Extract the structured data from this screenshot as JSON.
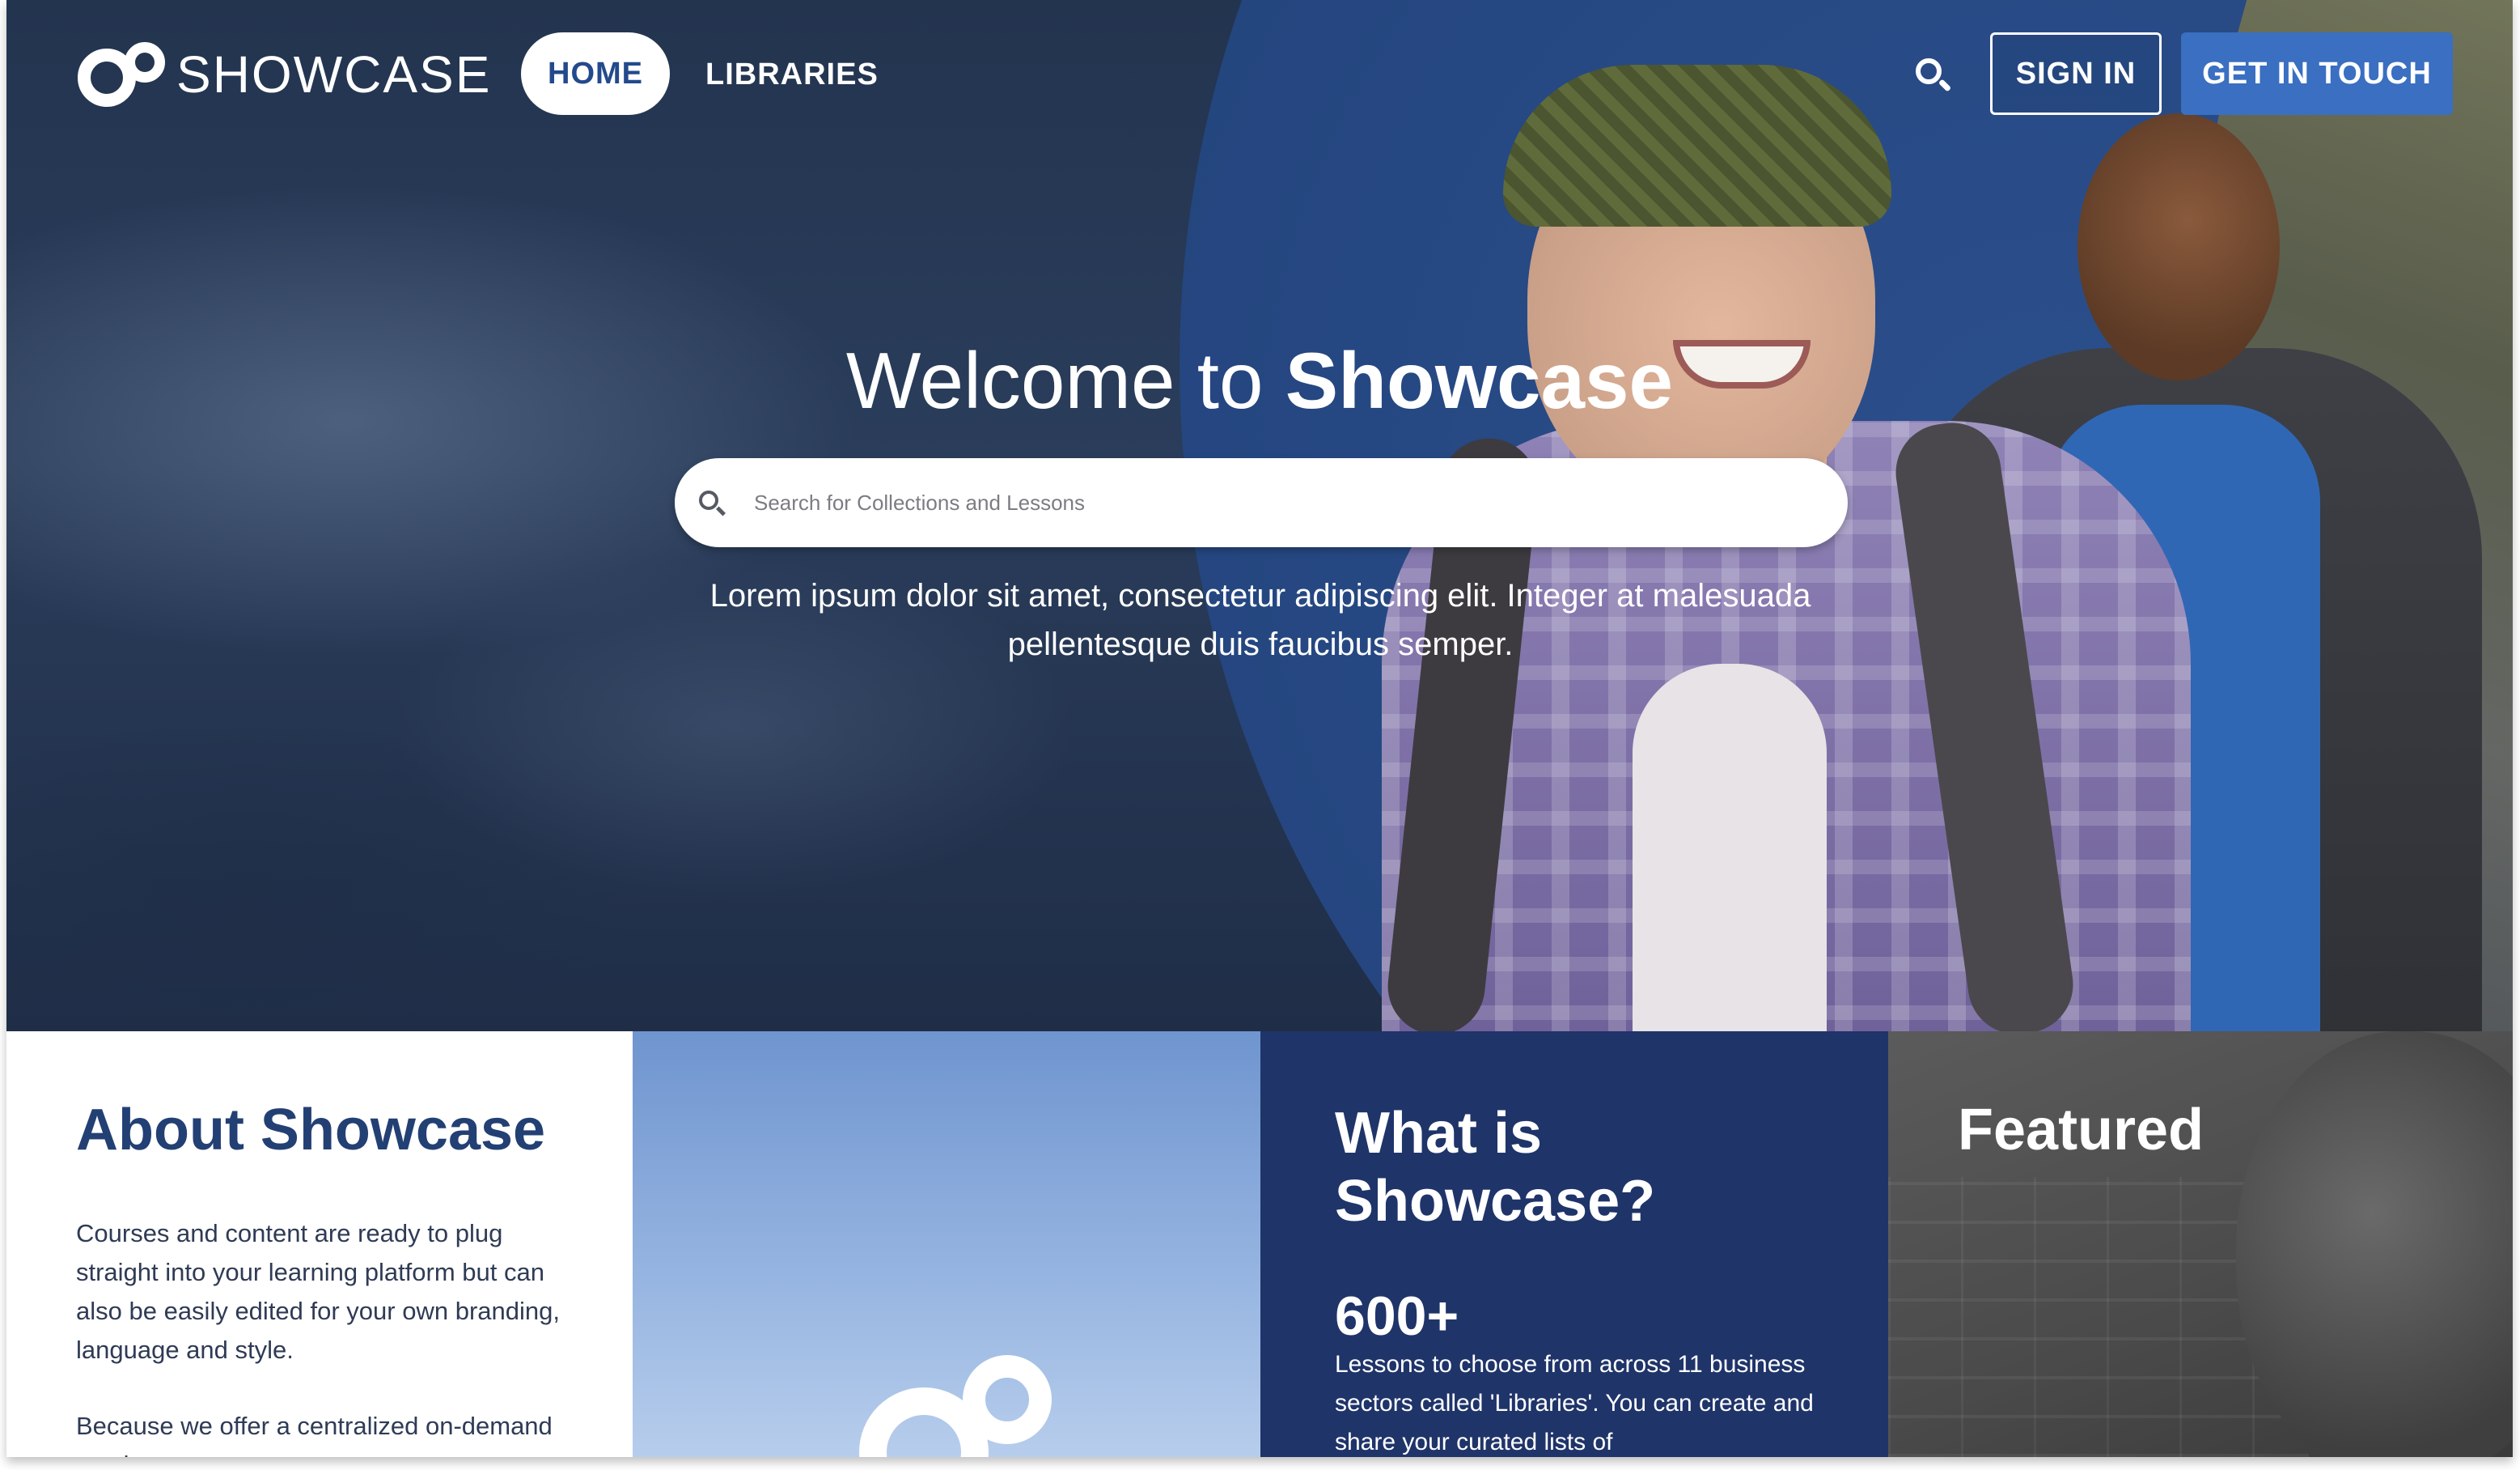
{
  "header": {
    "logo_text": "SHOWCASE",
    "nav_home": "HOME",
    "nav_libraries": "LIBRARIES",
    "sign_in": "SIGN IN",
    "get_in_touch": "GET IN TOUCH"
  },
  "hero": {
    "title_prefix": "Welcome to ",
    "title_brand": "Showcase",
    "search_placeholder": "Search for Collections and Lessons",
    "subtitle": "Lorem ipsum dolor sit amet, consectetur adipiscing elit. Integer at malesuada pellentesque duis faucibus semper."
  },
  "tiles": {
    "about": {
      "title": "About Showcase",
      "para1": "Courses and content are ready to plug straight into your learning platform but can also be easily edited for your own branding, language and style.",
      "para2": "Because we offer a centralized on-demand service, you can start"
    },
    "what": {
      "title": "What is Showcase?",
      "stat": "600+",
      "stat_desc": "Lessons to choose from across 11 business sectors called 'Libraries'. You can create and share your curated lists of"
    },
    "featured": {
      "title": "Featured"
    }
  },
  "colors": {
    "brand_blue": "#234a8c",
    "button_blue": "#3a6fc1",
    "navy_tile": "#1f3469",
    "about_title": "#234074"
  },
  "icons": {
    "search": "search-icon",
    "logo": "showcase-logo-icon"
  }
}
